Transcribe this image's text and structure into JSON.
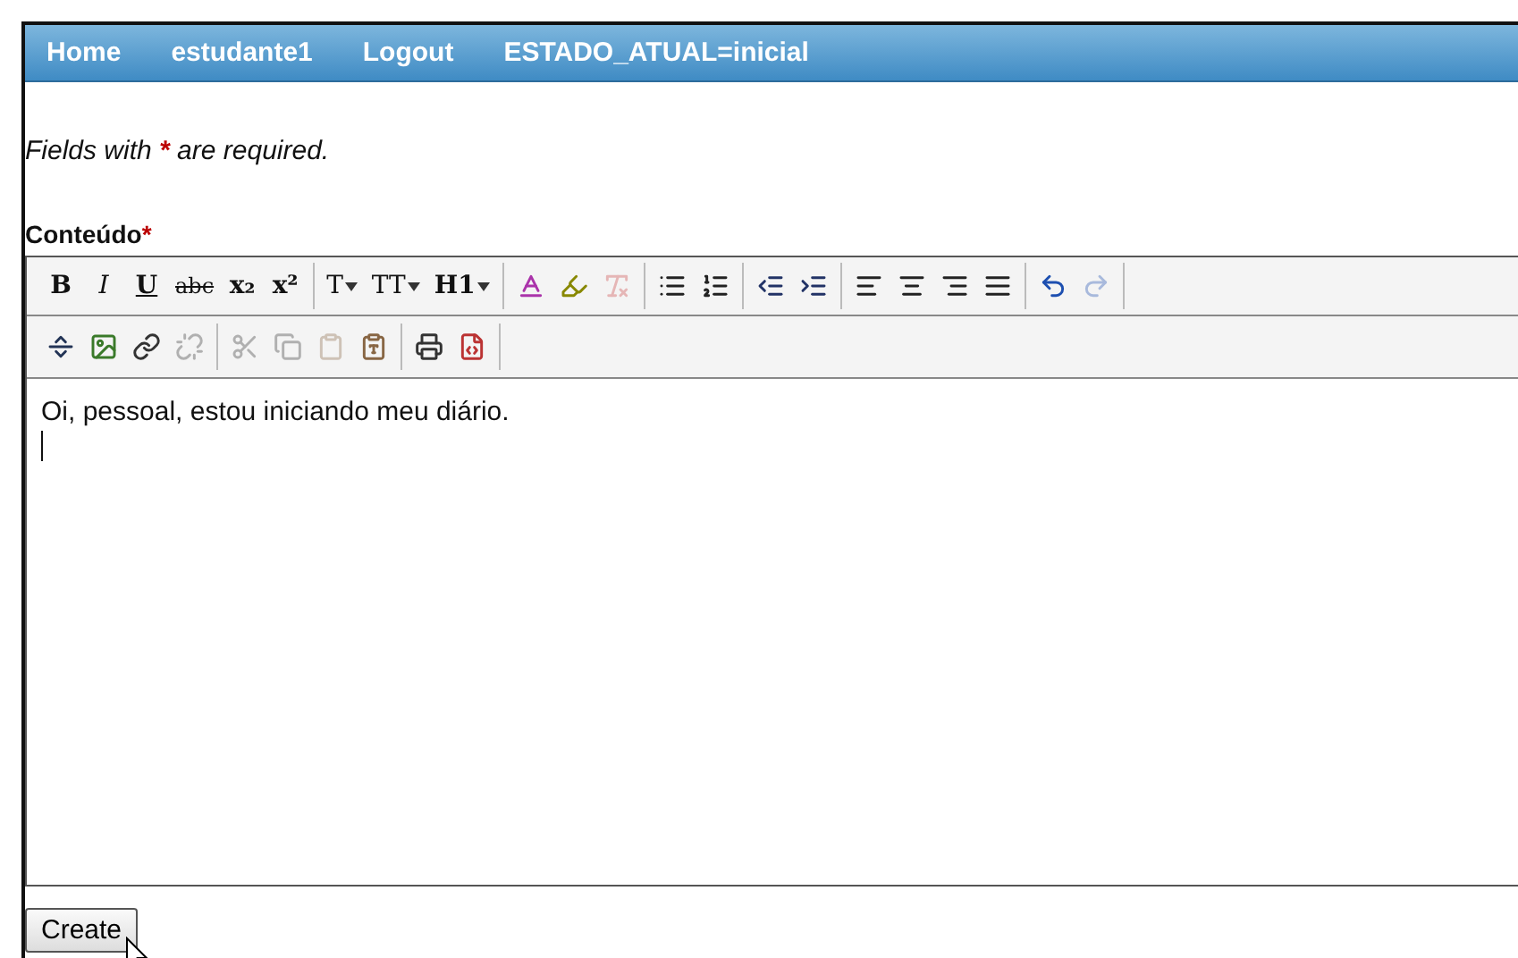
{
  "nav": [
    "Home",
    "estudante1",
    "Logout",
    "ESTADO_ATUAL=inicial"
  ],
  "note": {
    "before": "Fields with",
    "mark": "*",
    "after": "are required."
  },
  "field": {
    "label": "Conteúdo",
    "mark": "*"
  },
  "toolbar": [
    [
      [
        {
          "kind": "bold",
          "label": "B",
          "disabled": false
        },
        {
          "kind": "italic",
          "label": "I",
          "disabled": false
        },
        {
          "kind": "underline",
          "label": "U",
          "disabled": false
        },
        {
          "kind": "strike",
          "label": "abc",
          "disabled": false
        },
        {
          "kind": "sub",
          "label": "x₂",
          "disabled": false
        },
        {
          "kind": "sup",
          "label": "x²",
          "disabled": false
        }
      ],
      [
        {
          "kind": "font",
          "label": "T",
          "disabled": false
        },
        {
          "kind": "size",
          "label": "TT",
          "disabled": false
        },
        {
          "kind": "heading",
          "label": "H1",
          "disabled": false
        }
      ],
      [
        {
          "kind": "textcolor",
          "disabled": false
        },
        {
          "kind": "highlight",
          "disabled": false
        },
        {
          "kind": "removeformat",
          "disabled": true
        }
      ],
      [
        {
          "kind": "bullets",
          "disabled": false
        },
        {
          "kind": "numbers",
          "disabled": false
        }
      ],
      [
        {
          "kind": "outdent",
          "disabled": false
        },
        {
          "kind": "indent",
          "disabled": false
        }
      ],
      [
        {
          "kind": "left",
          "disabled": false
        },
        {
          "kind": "center",
          "disabled": false
        },
        {
          "kind": "right",
          "disabled": false
        },
        {
          "kind": "justify",
          "disabled": false
        }
      ],
      [
        {
          "kind": "undo",
          "disabled": false
        },
        {
          "kind": "redo",
          "disabled": true
        }
      ]
    ],
    [
      [
        {
          "kind": "hr",
          "disabled": false
        },
        {
          "kind": "image",
          "disabled": false
        },
        {
          "kind": "link",
          "disabled": false
        },
        {
          "kind": "unlink",
          "disabled": true
        }
      ],
      [
        {
          "kind": "cut",
          "disabled": true
        },
        {
          "kind": "copy",
          "disabled": true
        },
        {
          "kind": "paste",
          "disabled": true
        },
        {
          "kind": "pastetext",
          "disabled": false
        }
      ],
      [
        {
          "kind": "print",
          "disabled": false
        },
        {
          "kind": "source",
          "disabled": false
        }
      ]
    ]
  ],
  "content": "Oi, pessoal, estou iniciando meu diário.",
  "button": "Create"
}
